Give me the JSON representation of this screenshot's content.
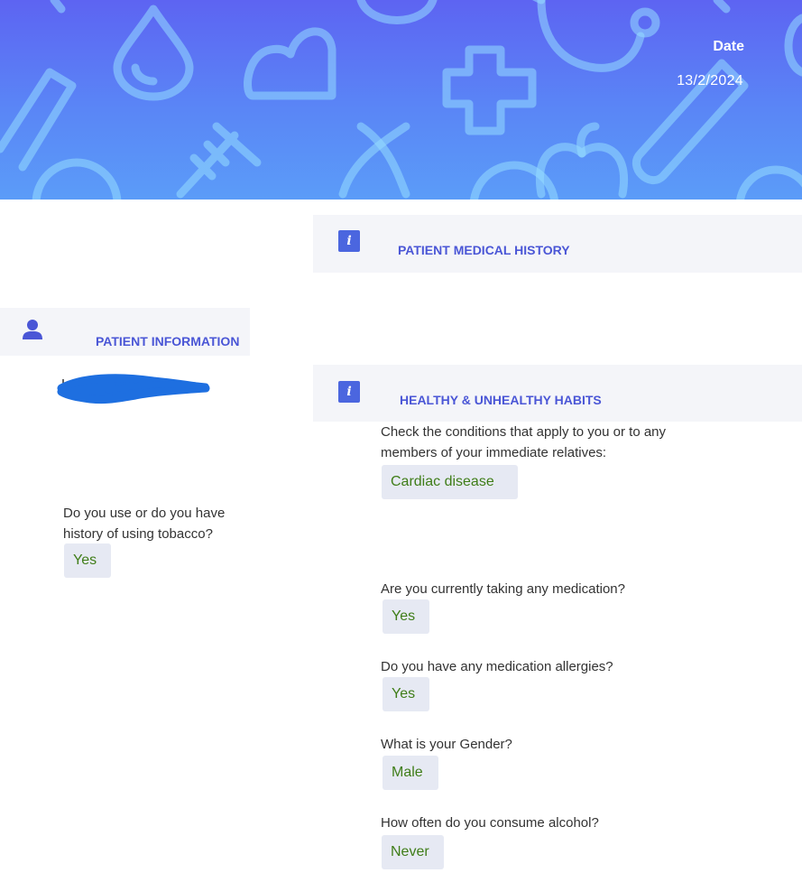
{
  "header": {
    "date_label": "Date",
    "date_value": "13/2/2024"
  },
  "sections": {
    "medical_history": {
      "title": "PATIENT MEDICAL HISTORY",
      "icon": "info-icon"
    },
    "patient_information": {
      "title": "PATIENT INFORMATION",
      "icon": "person-icon"
    },
    "habits": {
      "title": "HEALTHY & UNHEALTHY HABITS",
      "icon": "info-icon"
    }
  },
  "patient_info": {
    "name_redacted": true,
    "tobacco": {
      "question": "Do you use or do you have history of using tobacco?",
      "answer": "Yes"
    }
  },
  "habits": {
    "conditions": {
      "question": "Check the conditions that apply to you or to any members of your immediate relatives:",
      "answer": "Cardiac disease"
    },
    "medication": {
      "question": "Are you currently taking any medication?",
      "answer": "Yes"
    },
    "allergies": {
      "question": "Do you have any medication allergies?",
      "answer": "Yes"
    },
    "gender": {
      "question": "What is your Gender?",
      "answer": "Male"
    },
    "alcohol": {
      "question": "How often do you consume alcohol?",
      "answer": "Never"
    }
  },
  "colors": {
    "banner_top": "#5d64f2",
    "banner_bottom": "#5b9cf8",
    "section_title": "#4a56d6",
    "answer_text": "#3f7d18",
    "answer_bg": "#e6e9f3",
    "section_bg": "#f4f5f9"
  }
}
